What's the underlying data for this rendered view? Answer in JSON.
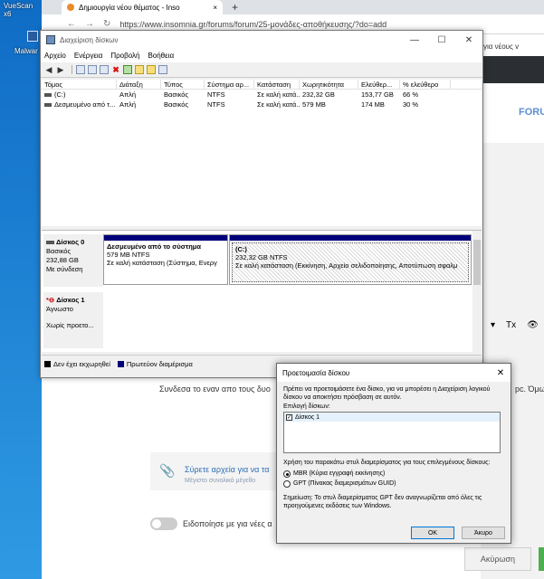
{
  "desktop": {
    "label_top": "VueScan x6",
    "label_mid": "Malwar"
  },
  "browser": {
    "tab_title": "Δημιουργία νέου θέματος - Inso",
    "tab_close": "×",
    "new_tab": "+",
    "nav_glyphs": [
      "←",
      "→",
      "↻"
    ],
    "url": "https://www.insomnia.gr/forums/forum/25-μονάδες-αποθήκευσης/?do=add"
  },
  "site": {
    "promo": "για νέους v",
    "forum_tab": "FORU",
    "editor_tools": [
      "▾",
      "Tx",
      "👁"
    ],
    "body_text": "Συνδεσα το εναν απο τους δυο",
    "body_text_right": "pc. Όμω",
    "upload_title": "Σύρετε αρχεία για να τα",
    "upload_sub": "Μέγιστο συνολικό μέγεθο",
    "notify_label": "Ειδοποίησε με για νέες α",
    "cancel_label": "Ακύρωση"
  },
  "dm": {
    "title": "Διαχείριση δίσκων",
    "win_controls": [
      "—",
      "☐",
      "✕"
    ],
    "menu": [
      "Αρχείο",
      "Ενέργεια",
      "Προβολή",
      "Βοήθεια"
    ],
    "toolbar": [
      "◀",
      "▶",
      "",
      "",
      "",
      "✖",
      "",
      "",
      "",
      ""
    ],
    "columns": [
      "Τόμος",
      "Διάταξη",
      "Τύπος",
      "Σύστημα αρ...",
      "Κατάσταση",
      "Χωρητικότητα",
      "Ελεύθερ...",
      "% ελεύθερο"
    ],
    "rows": [
      [
        "(C:)",
        "Απλή",
        "Βασικός",
        "NTFS",
        "Σε καλή κατά...",
        "232,32 GB",
        "153,77 GB",
        "66 %"
      ],
      [
        "Δεσμευμένο από τ...",
        "Απλή",
        "Βασικός",
        "NTFS",
        "Σε καλή κατά...",
        "579 MB",
        "174 MB",
        "30 %"
      ]
    ],
    "disk0": {
      "name": "Δίσκος 0",
      "type": "Βασικός",
      "size": "232,88 GB",
      "status": "Με σύνδεση",
      "part1": {
        "title": "Δεσμευμένο από το σύστημα",
        "size": "579 MB NTFS",
        "status": "Σε καλή κατάσταση (Σύστημα, Ενεργ"
      },
      "part2": {
        "title": "(C:)",
        "size": "232,32 GB NTFS",
        "status": "Σε καλή κατάσταση (Εκκίνηση, Αρχείο σελιδοποίησης, Αποτύπωση σφαλμ"
      }
    },
    "disk1": {
      "name": "Δίσκος 1",
      "type": "Άγνωστο",
      "status": "Χωρίς προετο..."
    },
    "legend": [
      {
        "label": "Δεν έχει εκχωρηθεί",
        "color": "#000000"
      },
      {
        "label": "Πρωτεύον διαμέρισμα",
        "color": "#00007a"
      }
    ]
  },
  "dialog": {
    "title": "Προετοιμασία δίσκου",
    "close": "✕",
    "intro": "Πρέπει να προετοιμάσετε ένα δίσκο, για να μπορέσει η Διαχείριση λογικού δίσκου να αποκτήσει πρόσβαση σε αυτόν.",
    "select_label": "Επιλογή δίσκων:",
    "disk_item": "Δίσκος 1",
    "style_label": "Χρήση του παρακάτω στυλ διαμερίσματος για τους επιλεγμένους δίσκους:",
    "mbr": "MBR (Κύρια εγγραφή εκκίνησης)",
    "gpt": "GPT (Πίνακας διαμερισμάτων GUID)",
    "note": "Σημείωση: Το στυλ διαμερίσματος GPT δεν αναγνωρίζεται από όλες τις προηγούμενες εκδόσεις των Windows.",
    "ok": "OK",
    "cancel": "Άκυρο"
  }
}
